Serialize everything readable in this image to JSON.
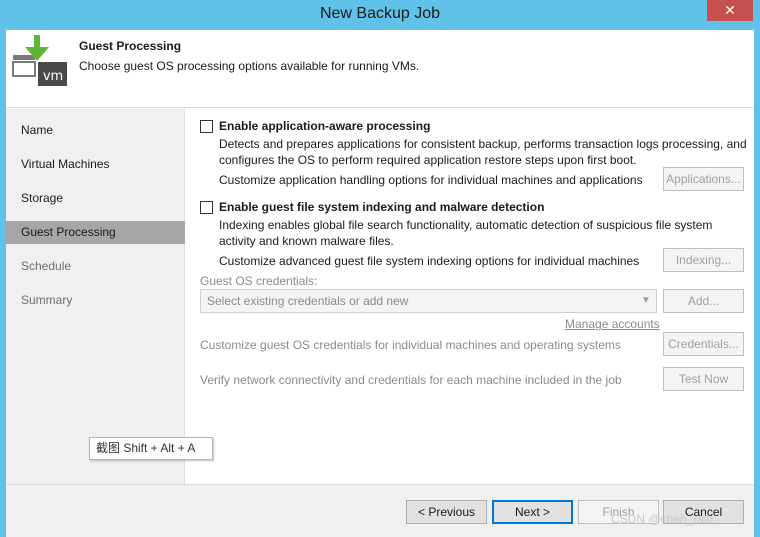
{
  "window": {
    "title": "New Backup Job",
    "close_glyph": "✕"
  },
  "header": {
    "title": "Guest Processing",
    "subtitle": "Choose guest OS processing options available for running VMs.",
    "icon_text": "vm",
    "icon": "vm-download-icon"
  },
  "sidebar": {
    "items": [
      {
        "label": "Name",
        "state": "normal"
      },
      {
        "label": "Virtual Machines",
        "state": "normal"
      },
      {
        "label": "Storage",
        "state": "normal"
      },
      {
        "label": "Guest Processing",
        "state": "active"
      },
      {
        "label": "Schedule",
        "state": "disabled"
      },
      {
        "label": "Summary",
        "state": "disabled"
      }
    ]
  },
  "app_processing": {
    "checked": false,
    "label": "Enable application-aware processing",
    "desc_line1": "Detects and prepares applications for consistent backup, performs transaction logs processing, and",
    "desc_line2": "configures the OS to perform required application restore steps upon first boot.",
    "customize_text": "Customize application handling options for individual machines and applications",
    "button_label": "Applications..."
  },
  "indexing": {
    "checked": false,
    "label": "Enable guest file system indexing and malware detection",
    "desc_line1": "Indexing enables global file search functionality, automatic detection of suspicious file system",
    "desc_line2": "activity and known malware files.",
    "customize_text": "Customize advanced guest file system indexing options for individual machines",
    "button_label": "Indexing..."
  },
  "credentials": {
    "label": "Guest OS credentials:",
    "select_value": "Select existing credentials or add new",
    "add_label": "Add...",
    "manage_link": "Manage accounts",
    "customize_text": "Customize guest OS credentials for individual machines and operating systems",
    "credentials_button": "Credentials...",
    "verify_text": "Verify network connectivity and credentials for each machine included in the job",
    "test_button": "Test Now"
  },
  "footer": {
    "previous": "< Previous",
    "next": "Next >",
    "finish": "Finish",
    "cancel": "Cancel"
  },
  "tooltip": {
    "text": "截图 Shift + Alt + A"
  },
  "watermark": {
    "text": "CSDN @chen_rain"
  },
  "colors": {
    "titlebar": "#61c2e9",
    "close": "#c74f50",
    "active_nav": "#a6a6a6",
    "icon_green": "#5fb337",
    "icon_dark": "#4a4a4a"
  }
}
